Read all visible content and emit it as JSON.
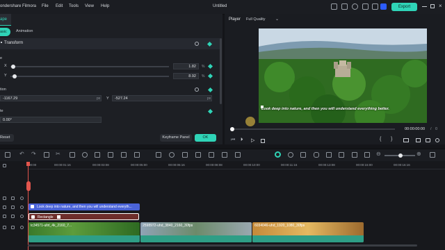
{
  "titlebar": {
    "app_name": "ondershare Filmora",
    "menu": [
      "File",
      "Edit",
      "Tools",
      "View",
      "Help"
    ],
    "doc_title": "Untitled",
    "export_label": "Export",
    "accent": "#2fd4b7"
  },
  "left_panel": {
    "tab_partial": "ape",
    "tabs": [
      "asic",
      "Animation"
    ],
    "transform_title": "Transform",
    "scale_label": "e",
    "x_label": "X",
    "x_value": "1.82",
    "y_label": "Y",
    "y_value": "8.92",
    "percent": "%",
    "position_label": "tion",
    "pos_x_value": "-1167.29",
    "pos_y_label": "Y",
    "pos_y_value": "-527.24",
    "px_unit": "px",
    "rotate_label": "te",
    "rotate_value": "0.00°",
    "reset_label": "Reset",
    "keyframe_label": "Keyframe Panel",
    "ok_label": "OK"
  },
  "player": {
    "player_label": "Player",
    "quality": "Full Quality",
    "caption": "Look deep into nature, and then you will understand everything better.",
    "current_time": "00:00:00:00",
    "slash": "/",
    "duration": "0"
  },
  "timeline": {
    "ruler_ticks": [
      "00:00",
      "00:00:01:16",
      "00:00:03:08",
      "00:00:05:00",
      "00:00:06:16",
      "00:00:08:08",
      "00:00:10:00",
      "00:00:11:16",
      "00:00:13:08",
      "00:00:15:00",
      "00:00:16:16"
    ],
    "text_clip": "Look deep into nature, and then you will understand everyth...",
    "rect_clip": "Rectangle",
    "video_clips": [
      "tc34571-ultrl_4k_2160_7...",
      "2598972-uhd_3840_2160_30fps",
      "6034046-uhd_1920_1080_30fps"
    ]
  }
}
